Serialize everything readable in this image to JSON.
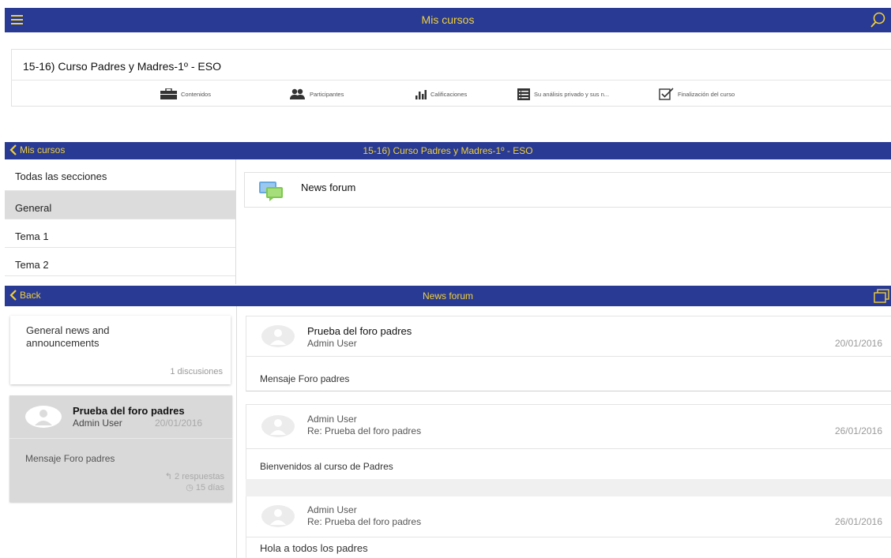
{
  "top_bar": {
    "title": "Mis cursos",
    "menu_icon": "hamburger-menu-icon",
    "search_icon": "search-icon",
    "bg_color": "#283a93",
    "text_color": "#f2d03a"
  },
  "course": {
    "title": "15-16) Curso Padres y Madres-1º - ESO",
    "tabs": [
      {
        "label": "Contenidos",
        "icon": "briefcase-icon"
      },
      {
        "label": "Participantes",
        "icon": "users-icon"
      },
      {
        "label": "Calificaciones",
        "icon": "bar-chart-icon"
      },
      {
        "label": "Su análisis privado y sus n...",
        "icon": "list-icon"
      },
      {
        "label": "Finalización del curso",
        "icon": "checkbox-icon"
      }
    ]
  },
  "course_bar": {
    "back_label": "Mis cursos",
    "title": "15-16) Curso Padres y Madres-1º - ESO"
  },
  "sections": {
    "items": [
      "Todas las secciones",
      "General",
      "Tema 1",
      "Tema 2"
    ],
    "active": "General"
  },
  "modules": [
    {
      "label": "News forum",
      "icon": "forum-icon"
    }
  ],
  "forum_bar": {
    "back_label": "Back",
    "title": "News forum",
    "window_icon": "window-icon"
  },
  "forum_info": {
    "name": "General news and announcements",
    "count": "1 discusiones"
  },
  "discussion": {
    "subject": "Prueba del foro padres",
    "author": "Admin User",
    "date": "20/01/2016",
    "message": "Mensaje Foro padres",
    "replies": "2 respuestas",
    "age": "15 días"
  },
  "posts": [
    {
      "subject": "Prueba del foro padres",
      "author": "Admin User",
      "date": "20/01/2016",
      "message": "Mensaje Foro padres"
    },
    {
      "author": "Admin User",
      "subject": "Re: Prueba del foro padres",
      "date": "26/01/2016",
      "message": "Bienvenidos al curso de Padres"
    },
    {
      "author": "Admin User",
      "subject": "Re: Prueba del foro padres",
      "date": "26/01/2016",
      "message": "Hola a todos los padres"
    }
  ]
}
